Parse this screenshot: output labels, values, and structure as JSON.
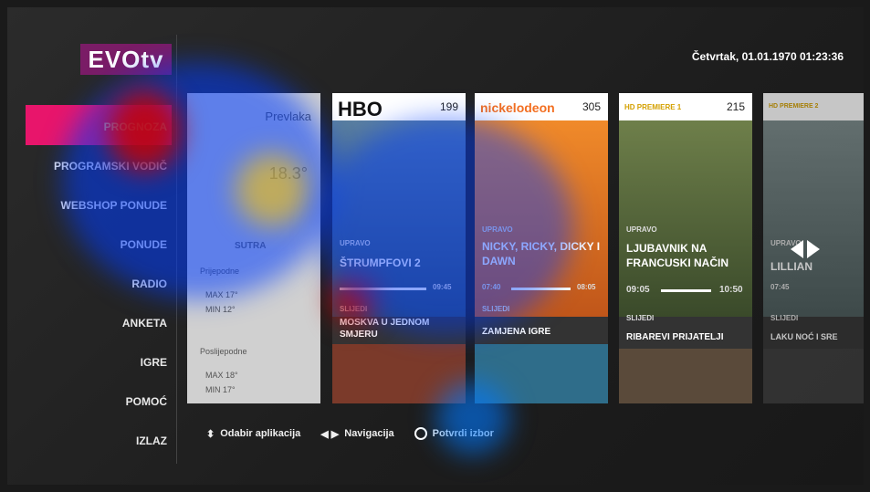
{
  "logo": "EVOtv",
  "datetime": "Četvrtak, 01.01.1970 01:23:36",
  "menu": [
    "PROGNOZA",
    "PROGRAMSKI VODIČ",
    "WEBSHOP PONUDE",
    "PONUDE",
    "RADIO",
    "ANKETA",
    "IGRE",
    "POMOĆ",
    "IZLAZ"
  ],
  "weather": {
    "city": "Prevlaka",
    "temp": "18.3°",
    "sutra": "SUTRA",
    "r1": "Prijepodne",
    "r2": "MAX 17°",
    "r3": "MIN 12°",
    "r4": "Poslijepodne",
    "r5": "MAX 18°",
    "r6": "MIN 17°"
  },
  "cards": [
    {
      "brand": "HBO",
      "num": "199",
      "upravo": "UPRAVO",
      "title": "ŠTRUMPFOVI 2",
      "start": "",
      "end": "09:45",
      "slijedi": "SLIJEDI",
      "next": "MOSKVA U JEDNOM SMJERU"
    },
    {
      "brand": "nickelodeon",
      "num": "305",
      "upravo": "UPRAVO",
      "title": "NICKY, RICKY, DICKY I DAWN",
      "start": "07:40",
      "end": "08:05",
      "slijedi": "SLIJEDI",
      "next": "ZAMJENA IGRE"
    },
    {
      "brand": "HD PREMIERE 1",
      "num": "215",
      "upravo": "UPRAVO",
      "title": "LJUBAVNIK NA FRANCUSKI NAČIN",
      "start": "09:05",
      "end": "10:50",
      "slijedi": "SLIJEDI",
      "next": "RIBAREVI PRIJATELJI"
    },
    {
      "brand": "HD PREMIERE 2",
      "num": "",
      "upravo": "UPRAVO",
      "title": "LILLIAN",
      "start": "07:45",
      "end": "",
      "slijedi": "SLIJEDI",
      "next": "LAKU NOĆ I SRE"
    }
  ],
  "footer": {
    "a": "Odabir aplikacija",
    "b": "Navigacija",
    "c": "Potvrdi izbor"
  }
}
